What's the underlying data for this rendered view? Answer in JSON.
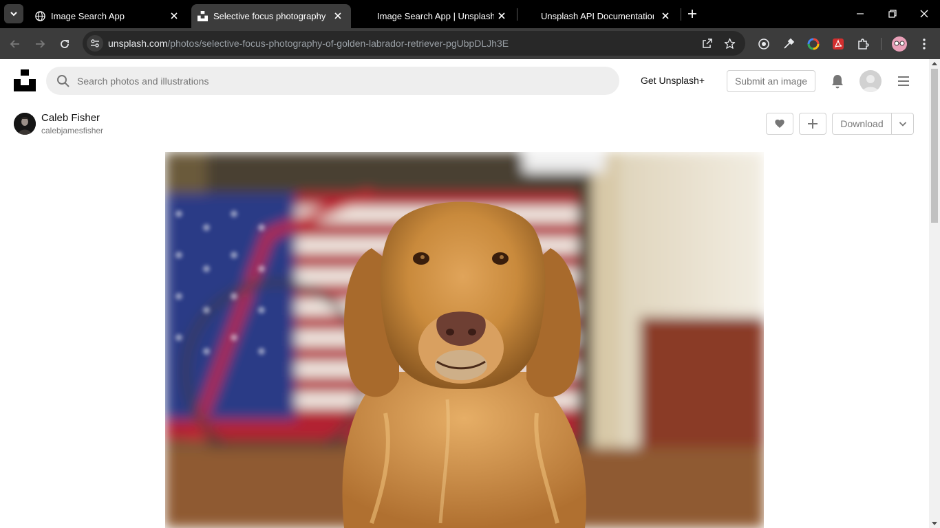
{
  "browser": {
    "tabs": [
      {
        "title": "Image Search App",
        "favicon": "globe-icon",
        "active": false
      },
      {
        "title": "Selective focus photography of",
        "favicon": "unsplash-icon",
        "active": true
      },
      {
        "title": "Image Search App | Unsplash",
        "favicon": "none",
        "active": false
      },
      {
        "title": "Unsplash API Documentation | Fr",
        "favicon": "none",
        "active": false
      }
    ],
    "url_host": "unsplash.com",
    "url_path": "/photos/selective-focus-photography-of-golden-labrador-retriever-pgUbpDLJh3E"
  },
  "header": {
    "search_placeholder": "Search photos and illustrations",
    "get_plus_label": "Get Unsplash+",
    "submit_label": "Submit an image"
  },
  "author": {
    "name": "Caleb Fisher",
    "handle": "calebjamesfisher"
  },
  "actions": {
    "download_label": "Download"
  },
  "colors": {
    "chrome_dark": "#000000",
    "toolbar": "#3c3c3c",
    "page_bg": "#ffffff",
    "search_bg": "#eeeeee",
    "muted_text": "#767676"
  }
}
